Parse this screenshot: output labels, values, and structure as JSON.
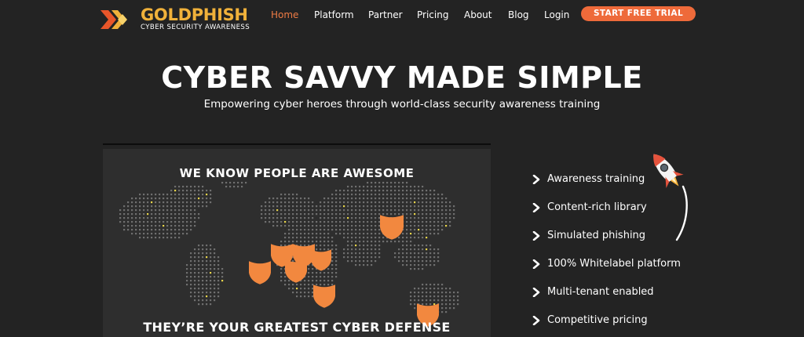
{
  "brand": {
    "name": "GOLDPHISH",
    "tagline": "CYBER SECURITY AWARENESS"
  },
  "nav": {
    "items": [
      {
        "label": "Home",
        "active": true
      },
      {
        "label": "Platform",
        "active": false
      },
      {
        "label": "Partner",
        "active": false
      },
      {
        "label": "Pricing",
        "active": false
      },
      {
        "label": "About",
        "active": false
      },
      {
        "label": "Blog",
        "active": false
      },
      {
        "label": "Login",
        "active": false
      }
    ],
    "cta_label": "START FREE TRIAL"
  },
  "hero": {
    "title": "CYBER SAVVY MADE SIMPLE",
    "subtitle": "Empowering cyber heroes through world-class security awareness training"
  },
  "media": {
    "heading": "WE KNOW PEOPLE ARE AWESOME",
    "footer": "THEY’RE YOUR GREATEST CYBER DEFENSE"
  },
  "features": [
    {
      "label": "Awareness training"
    },
    {
      "label": "Content-rich library"
    },
    {
      "label": "Simulated phishing"
    },
    {
      "label": "100% Whitelabel platform"
    },
    {
      "label": "Multi-tenant enabled"
    },
    {
      "label": "Competitive pricing"
    }
  ],
  "colors": {
    "background": "#232323",
    "accent": "#ee6a3a",
    "brand_gold": "#f0b13a",
    "active_nav": "#ee7b44",
    "shield": "#f2883f"
  },
  "icons": {
    "logo": "goldphish-logo-icon",
    "feature_bullet": "chevron-right-icon",
    "rocket": "rocket-icon",
    "shield": "shield-icon"
  }
}
